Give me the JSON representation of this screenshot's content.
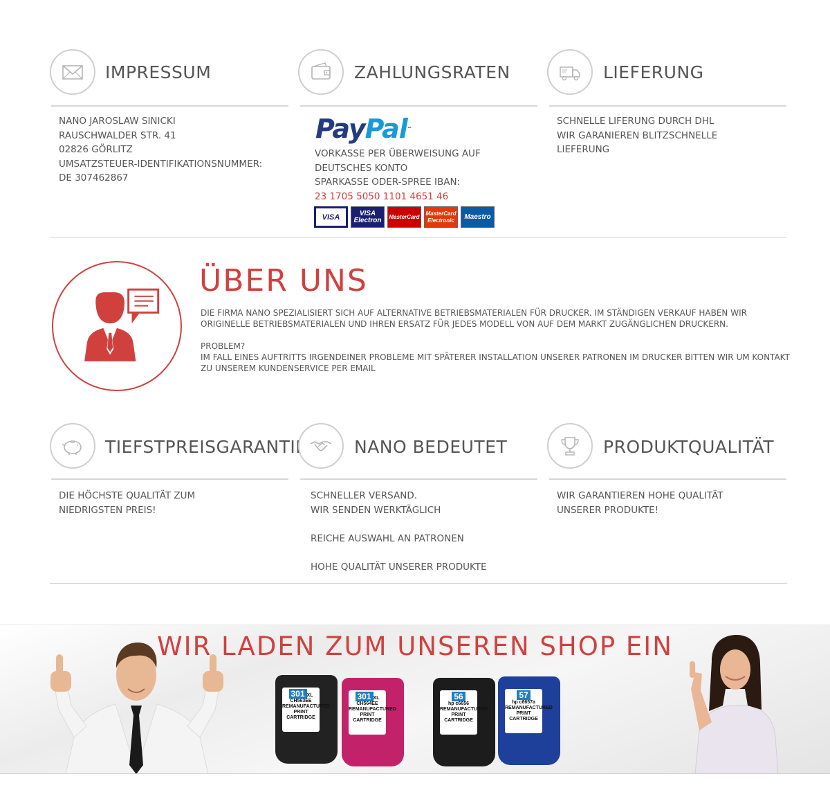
{
  "sections_top": [
    {
      "title": "IMPRESSUM",
      "icon": "envelope-icon",
      "lines": [
        "NANO JAROSLAW SINICKI",
        "RAUSCHWALDER STR. 41",
        "02826 GÖRLITZ",
        "UMSATZSTEUER-IDENTIFIKATIONSNUMMER:",
        "DE 307462867"
      ]
    },
    {
      "title": "ZAHLUNGSRATEN",
      "icon": "wallet-icon",
      "paypal_logo": {
        "part1": "Pay",
        "part2": "Pal",
        "tm": "™"
      },
      "lines": [
        "VORKASSE PER ÜBERWEISUNG AUF",
        "DEUTSCHES KONTO",
        "SPARKASSE ODER-SPREE IBAN:"
      ],
      "iban": "23 1705 5050 1101 4651 46",
      "cards": [
        "VISA",
        "VISA\nElectron",
        "MasterCard",
        "MasterCard\nElectronic",
        "Maestro"
      ]
    },
    {
      "title": "LIEFERUNG",
      "icon": "truck-icon",
      "lines": [
        "SCHNELLE LIFERUNG DURCH DHL",
        "WIR GARANIEREN BLITZSCHNELLE",
        "LIEFERUNG"
      ]
    }
  ],
  "about": {
    "title": "ÜBER UNS",
    "icon": "customer-service-person-icon",
    "paragraph": "DIE FIRMA NANO SPEZIALISIERT SICH AUF ALTERNATIVE BETRIEBSMATERIALEN FÜR DRUCKER. IM STÄNDIGEN VERKAUF HABEN WIR ORIGINELLE BETRIEBSMATERIALEN UND IHREN ERSATZ FÜR JEDES MODELL VON AUF DEM MARKT ZUGÄNGLICHEN DRUCKERN.",
    "problem_label": "PROBLEM?",
    "problem_text": "IM FALL EINES AUFTRITTS IRGENDEINER PROBLEME MIT SPÄTERER INSTALLATION UNSERER PATRONEN IM DRUCKER BITTEN WIR UM KONTAKT ZU UNSEREM KUNDENSERVICE PER EMAIL"
  },
  "sections_bottom": [
    {
      "title": "TIEFSTPREISGARANTIE",
      "icon": "piggy-bank-icon",
      "lines": [
        "DIE HÖCHSTE QUALITÄT ZUM",
        "NIEDRIGSTEN PREIS!"
      ]
    },
    {
      "title": "NANO BEDEUTET",
      "icon": "handshake-icon",
      "lines": [
        "SCHNELLER VERSAND.",
        "WIR SENDEN WERKTÄGLICH",
        "",
        "REICHE AUSWAHL AN PATRONEN",
        "",
        "HOHE QUALITÄT UNSERER PRODUKTE"
      ]
    },
    {
      "title": "PRODUKTQUALITÄT",
      "icon": "trophy-icon",
      "lines": [
        "WIR GARANTIEREN HOHE QUALITÄT",
        "UNSERER PRODUKTE!"
      ]
    }
  ],
  "banner": {
    "title": "WIR LADEN ZUM UNSEREN SHOP EIN",
    "cartridges": [
      {
        "num": "301",
        "suffix": "XL",
        "code": "CH563EE",
        "color": "#222222"
      },
      {
        "num": "301",
        "suffix": "XL",
        "code": "CH564EE",
        "color": "#c2226a"
      },
      {
        "num": "56",
        "suffix": "",
        "code": "hp c6656",
        "color": "#1c1c1c"
      },
      {
        "num": "57",
        "suffix": "",
        "code": "hp c6657a",
        "color": "#1e3f9a"
      }
    ],
    "cartridge_text": [
      "REMANUFACTURED",
      "PRINT",
      "CARTRIDGE"
    ]
  }
}
